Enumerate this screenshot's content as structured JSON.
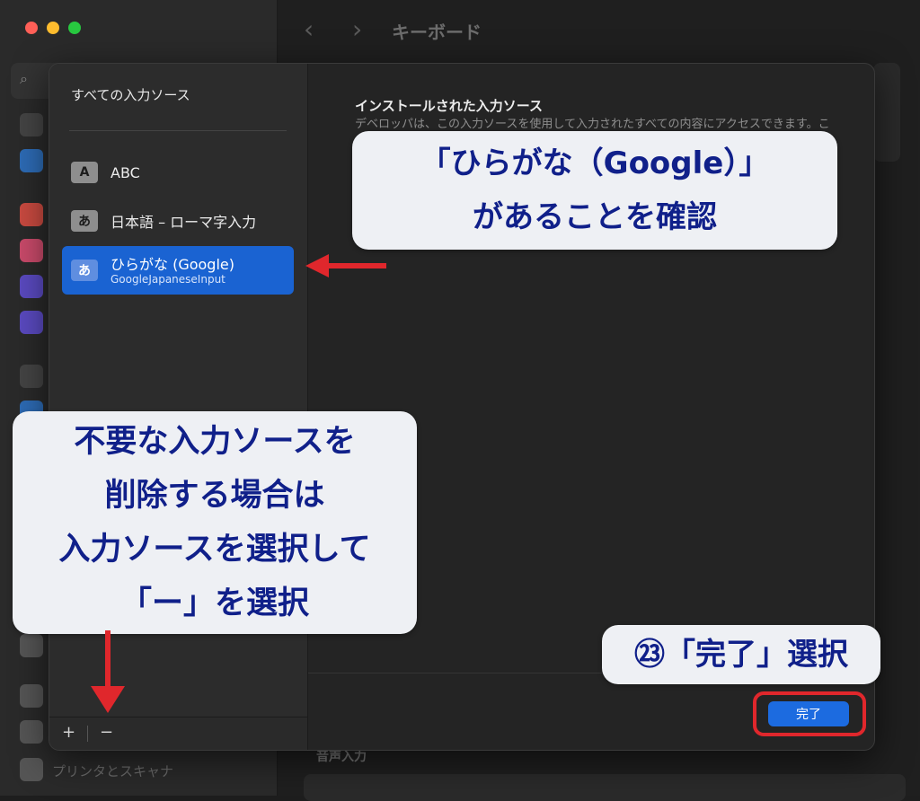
{
  "window": {
    "title": "キーボード",
    "back_glyph": "‹",
    "forward_glyph": "›",
    "search_glyph": "⌕",
    "sidebar_bottom_item": "プリンタとスキャナ",
    "bg_section_label": "音声入力"
  },
  "sheet": {
    "left_title": "すべての入力ソース",
    "sources": [
      {
        "badge": "A",
        "label": "ABC"
      },
      {
        "badge": "あ",
        "label": "日本語 – ローマ字入力"
      },
      {
        "badge": "あ",
        "label": "ひらがな (Google)",
        "sublabel": "GoogleJapaneseInput",
        "selected": true
      }
    ],
    "add_glyph": "+",
    "remove_glyph": "−",
    "right_title": "インストールされた入力ソース",
    "right_description": "デベロッパは、この入力ソースを使用して入力されたすべての内容にアクセスできます。これにはクレジットカード番号や住所などの個人情報が含まれる可能性があります。",
    "done_label": "完了"
  },
  "annotations": {
    "confirm_line1": "「ひらがな（Google）」",
    "confirm_line2": "があることを確認",
    "delete_line1": "不要な入力ソースを",
    "delete_line2": "削除する場合は",
    "delete_line3": "入力ソースを選択して",
    "delete_line4": "「ー」を選択",
    "done_step": "㉓「完了」選択"
  },
  "colors": {
    "selection": "#1a63d2",
    "annotation_text": "#10208a",
    "annotation_bg": "#eef0f4",
    "highlight": "#e0272c",
    "done_button": "#1c6be0"
  }
}
